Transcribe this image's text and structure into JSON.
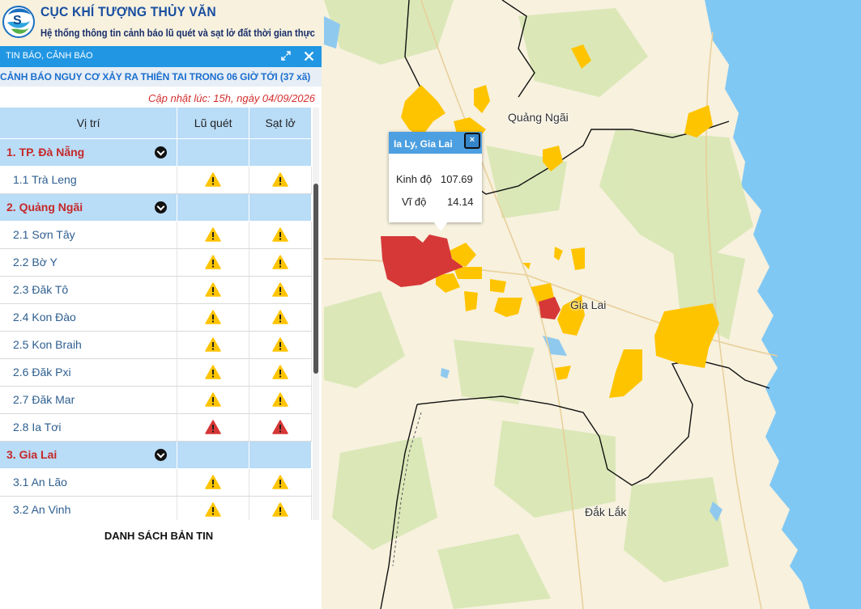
{
  "header": {
    "agency": "CỤC KHÍ TƯỢNG THỦY VĂN",
    "subtitle": "Hệ thống thông tin cảnh báo lũ quét và sạt lở đất thời gian thực"
  },
  "panel": {
    "title": "TIN BÁO, CẢNH BÁO",
    "heading": "CẢNH BÁO NGUY CƠ XẢY RA THIÊN TAI TRONG 06 GIỜ TỚI (37 xã)",
    "updated": "Cập nhật lúc: 15h, ngày 04/09/2026",
    "columns": {
      "location": "Vị trí",
      "flash_flood": "Lũ quét",
      "landslide": "Sạt lở"
    },
    "provinces": [
      {
        "name": "1. TP. Đà Nẵng",
        "items": [
          {
            "name": "1.1 Trà Leng",
            "flash_flood": "yellow",
            "landslide": "yellow"
          }
        ]
      },
      {
        "name": "2. Quảng Ngãi",
        "items": [
          {
            "name": "2.1 Sơn Tây",
            "flash_flood": "yellow",
            "landslide": "yellow"
          },
          {
            "name": "2.2 Bờ Y",
            "flash_flood": "yellow",
            "landslide": "yellow"
          },
          {
            "name": "2.3 Đăk Tô",
            "flash_flood": "yellow",
            "landslide": "yellow"
          },
          {
            "name": "2.4 Kon Đào",
            "flash_flood": "yellow",
            "landslide": "yellow"
          },
          {
            "name": "2.5 Kon Braih",
            "flash_flood": "yellow",
            "landslide": "yellow"
          },
          {
            "name": "2.6 Đăk Pxi",
            "flash_flood": "yellow",
            "landslide": "yellow"
          },
          {
            "name": "2.7 Đăk Mar",
            "flash_flood": "yellow",
            "landslide": "yellow"
          },
          {
            "name": "2.8 Ia Tơi",
            "flash_flood": "red",
            "landslide": "red"
          }
        ]
      },
      {
        "name": "3. Gia Lai",
        "items": [
          {
            "name": "3.1 An Lão",
            "flash_flood": "yellow",
            "landslide": "yellow"
          },
          {
            "name": "3.2 An Vinh",
            "flash_flood": "yellow",
            "landslide": "yellow"
          }
        ]
      }
    ],
    "bulletin_link": "DANH SÁCH BẢN TIN"
  },
  "popup": {
    "title": "Ia Ly, Gia Lai",
    "close": "×",
    "lon_label": "Kinh độ",
    "lon_value": "107.69",
    "lat_label": "Vĩ độ",
    "lat_value": "14.14"
  },
  "map": {
    "labels": {
      "quang_ngai": "Quảng Ngãi",
      "gia_lai": "Gia Lai",
      "dak_lak": "Đắk Lắk"
    },
    "colors": {
      "yellow": "#ffc400",
      "red": "#d63636",
      "sea": "#7cc6f2",
      "land": "#f6f0dc",
      "forest": "#d8e7b5"
    }
  },
  "icons": {
    "expand": "expand-icon",
    "close": "close-icon",
    "warning": "warning-triangle-icon",
    "chevron": "chevron-down-icon",
    "logo": "agency-logo"
  }
}
